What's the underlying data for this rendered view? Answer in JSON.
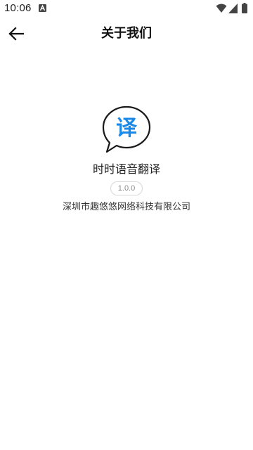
{
  "status_bar": {
    "time": "10:06",
    "notification_icon": "notification-a-icon",
    "wifi_icon": "wifi-icon",
    "signal_icon": "cellular-signal-icon",
    "battery_icon": "battery-icon"
  },
  "app_bar": {
    "title": "关于我们",
    "back_icon": "arrow-back-icon"
  },
  "about": {
    "logo_text": "译",
    "logo_color": "#1a88e6",
    "app_name": "时时语音翻译",
    "version": "1.0.0",
    "company": "深圳市趣悠悠网络科技有限公司"
  }
}
